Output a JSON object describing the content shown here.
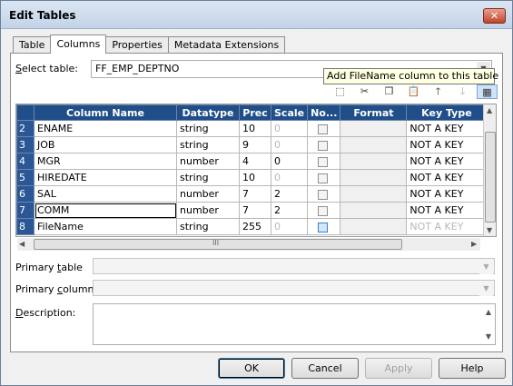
{
  "window": {
    "title": "Edit Tables",
    "close_glyph": "✕"
  },
  "tabs": [
    {
      "label": "Table"
    },
    {
      "label": "Columns"
    },
    {
      "label": "Properties"
    },
    {
      "label": "Metadata Extensions"
    }
  ],
  "active_tab": "Columns",
  "select_table": {
    "label": "Select table:",
    "value": "FF_EMP_DEPTNO"
  },
  "tooltip": "Add FileName column to this table",
  "toolbar": [
    {
      "icon": "new-column-icon",
      "glyph": "⬚",
      "enabled": true
    },
    {
      "icon": "cut-icon",
      "glyph": "✂",
      "enabled": true
    },
    {
      "icon": "copy-icon",
      "glyph": "❐",
      "enabled": true
    },
    {
      "icon": "paste-icon",
      "glyph": "📋",
      "enabled": false
    },
    {
      "icon": "move-up-icon",
      "glyph": "🡑",
      "enabled": true
    },
    {
      "icon": "move-down-icon",
      "glyph": "🡓",
      "enabled": false
    },
    {
      "icon": "add-filename-column-icon",
      "glyph": "▦",
      "enabled": true
    }
  ],
  "grid": {
    "headers": [
      "Column Name",
      "Datatype",
      "Prec",
      "Scale",
      "No...",
      "Format",
      "Key Type"
    ],
    "rows": [
      {
        "num": "2",
        "name": "ENAME",
        "datatype": "string",
        "prec": "10",
        "scale": "0",
        "scale_disabled": true,
        "key": "NOT A KEY"
      },
      {
        "num": "3",
        "name": "JOB",
        "datatype": "string",
        "prec": "9",
        "scale": "0",
        "scale_disabled": true,
        "key": "NOT A KEY"
      },
      {
        "num": "4",
        "name": "MGR",
        "datatype": "number",
        "prec": "4",
        "scale": "0",
        "scale_disabled": false,
        "key": "NOT A KEY"
      },
      {
        "num": "5",
        "name": "HIREDATE",
        "datatype": "string",
        "prec": "10",
        "scale": "0",
        "scale_disabled": true,
        "key": "NOT A KEY"
      },
      {
        "num": "6",
        "name": "SAL",
        "datatype": "number",
        "prec": "7",
        "scale": "2",
        "scale_disabled": false,
        "key": "NOT A KEY"
      },
      {
        "num": "7",
        "name": "COMM",
        "datatype": "number",
        "prec": "7",
        "scale": "2",
        "scale_disabled": false,
        "key": "NOT A KEY"
      },
      {
        "num": "8",
        "name": "FileName",
        "datatype": "string",
        "prec": "255",
        "scale": "0",
        "scale_disabled": true,
        "key": "NOT A KEY"
      }
    ],
    "hscroll_glyph": "III"
  },
  "primary_table": {
    "label": "Primary table",
    "value": ""
  },
  "primary_column": {
    "label": "Primary column:",
    "value": ""
  },
  "description": {
    "label": "Description:",
    "value": ""
  },
  "buttons": {
    "ok": "OK",
    "cancel": "Cancel",
    "apply": "Apply",
    "help": "Help"
  }
}
